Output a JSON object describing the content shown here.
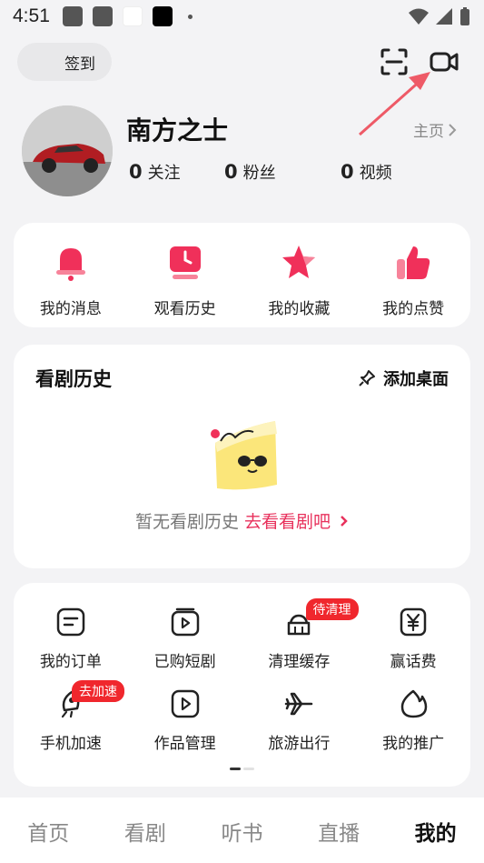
{
  "status_bar": {
    "time": "4:51"
  },
  "header": {
    "checkin_label": "签到",
    "icons": [
      "scan-icon",
      "video-camera-icon"
    ]
  },
  "profile": {
    "name": "南方之士",
    "homepage_label": "主页",
    "stats": [
      {
        "value": "0",
        "label": "关注"
      },
      {
        "value": "0",
        "label": "粉丝"
      },
      {
        "value": "0",
        "label": "视频"
      }
    ]
  },
  "quick_actions": [
    {
      "label": "我的消息",
      "icon": "bell-icon"
    },
    {
      "label": "观看历史",
      "icon": "clock-icon"
    },
    {
      "label": "我的收藏",
      "icon": "star-icon"
    },
    {
      "label": "我的点赞",
      "icon": "thumbs-up-icon"
    }
  ],
  "history": {
    "title": "看剧历史",
    "add_desktop_label": "添加桌面",
    "empty_text": "暂无看剧历史",
    "cta_text": "去看看剧吧"
  },
  "services": {
    "row1": [
      {
        "label": "我的订单",
        "icon": "order-icon"
      },
      {
        "label": "已购短剧",
        "icon": "purchased-play-icon"
      },
      {
        "label": "清理缓存",
        "icon": "broom-icon",
        "badge": "待清理"
      },
      {
        "label": "赢话费",
        "icon": "yuan-icon"
      }
    ],
    "row2": [
      {
        "label": "手机加速",
        "icon": "rocket-icon",
        "badge": "去加速"
      },
      {
        "label": "作品管理",
        "icon": "works-play-icon"
      },
      {
        "label": "旅游出行",
        "icon": "airplane-icon"
      },
      {
        "label": "我的推广",
        "icon": "flame-icon"
      }
    ]
  },
  "tabbar": {
    "tabs": [
      "首页",
      "看剧",
      "听书",
      "直播",
      "我的"
    ],
    "active": "我的"
  },
  "colors": {
    "accent": "#e8315c",
    "badge": "#f0272d",
    "background": "#f3f3f5"
  }
}
